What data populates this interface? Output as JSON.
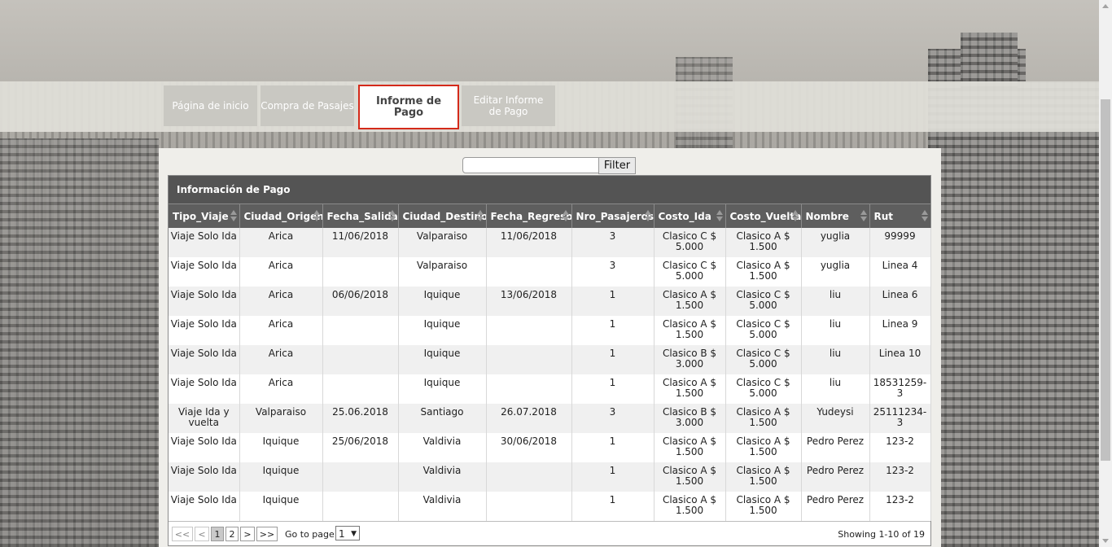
{
  "nav": {
    "tabs": [
      {
        "label": "Página de inicio"
      },
      {
        "label": "Compra de Pasajes"
      },
      {
        "label": "Informe de Pago"
      },
      {
        "label": "Editar Informe de Pago"
      }
    ],
    "active_tab": "Informe de Pago"
  },
  "filter": {
    "input_value": "",
    "button_label": "Filter"
  },
  "grid": {
    "caption": "Información de Pago",
    "columns": [
      "Tipo_Viaje",
      "Ciudad_Origen",
      "Fecha_Salida",
      "Ciudad_Destino",
      "Fecha_Regreso",
      "Nro_Pasajeros",
      "Costo_Ida",
      "Costo_Vuelta",
      "Nombre",
      "Rut"
    ],
    "rows": [
      [
        "Viaje Solo Ida",
        "Arica",
        "11/06/2018",
        "Valparaiso",
        "11/06/2018",
        "3",
        "Clasico C $ 5.000",
        "Clasico A $ 1.500",
        "yuglia",
        "99999"
      ],
      [
        "Viaje Solo Ida",
        "Arica",
        "",
        "Valparaiso",
        "",
        "3",
        "Clasico C $ 5.000",
        "Clasico A $ 1.500",
        "yuglia",
        "Linea 4"
      ],
      [
        "Viaje Solo Ida",
        "Arica",
        "06/06/2018",
        "Iquique",
        "13/06/2018",
        "1",
        "Clasico A $ 1.500",
        "Clasico C $ 5.000",
        "liu",
        "Linea 6"
      ],
      [
        "Viaje Solo Ida",
        "Arica",
        "",
        "Iquique",
        "",
        "1",
        "Clasico A $ 1.500",
        "Clasico C $ 5.000",
        "liu",
        "Linea 9"
      ],
      [
        "Viaje Solo Ida",
        "Arica",
        "",
        "Iquique",
        "",
        "1",
        "Clasico B $ 3.000",
        "Clasico C $ 5.000",
        "liu",
        "Linea 10"
      ],
      [
        "Viaje Solo Ida",
        "Arica",
        "",
        "Iquique",
        "",
        "1",
        "Clasico A $ 1.500",
        "Clasico C $ 5.000",
        "liu",
        "18531259-3"
      ],
      [
        "Viaje Ida y vuelta",
        "Valparaiso",
        "25.06.2018",
        "Santiago",
        "26.07.2018",
        "3",
        "Clasico B $ 3.000",
        "Clasico A $ 1.500",
        "Yudeysi",
        "25111234-3"
      ],
      [
        "Viaje Solo Ida",
        "Iquique",
        "25/06/2018",
        "Valdivia",
        "30/06/2018",
        "1",
        "Clasico A $ 1.500",
        "Clasico A $ 1.500",
        "Pedro Perez",
        "123-2"
      ],
      [
        "Viaje Solo Ida",
        "Iquique",
        "",
        "Valdivia",
        "",
        "1",
        "Clasico A $ 1.500",
        "Clasico A $ 1.500",
        "Pedro Perez",
        "123-2"
      ],
      [
        "Viaje Solo Ida",
        "Iquique",
        "",
        "Valdivia",
        "",
        "1",
        "Clasico A $ 1.500",
        "Clasico A $ 1.500",
        "Pedro Perez",
        "123-2"
      ]
    ]
  },
  "pager": {
    "first": "<<",
    "prev": "<",
    "pages": [
      "1",
      "2"
    ],
    "current_page": "1",
    "next": ">",
    "last": ">>",
    "goto_label": "Go to page:",
    "goto_value": "1",
    "goto_arrow": "▼",
    "showing": "Showing 1-10 of 19"
  }
}
